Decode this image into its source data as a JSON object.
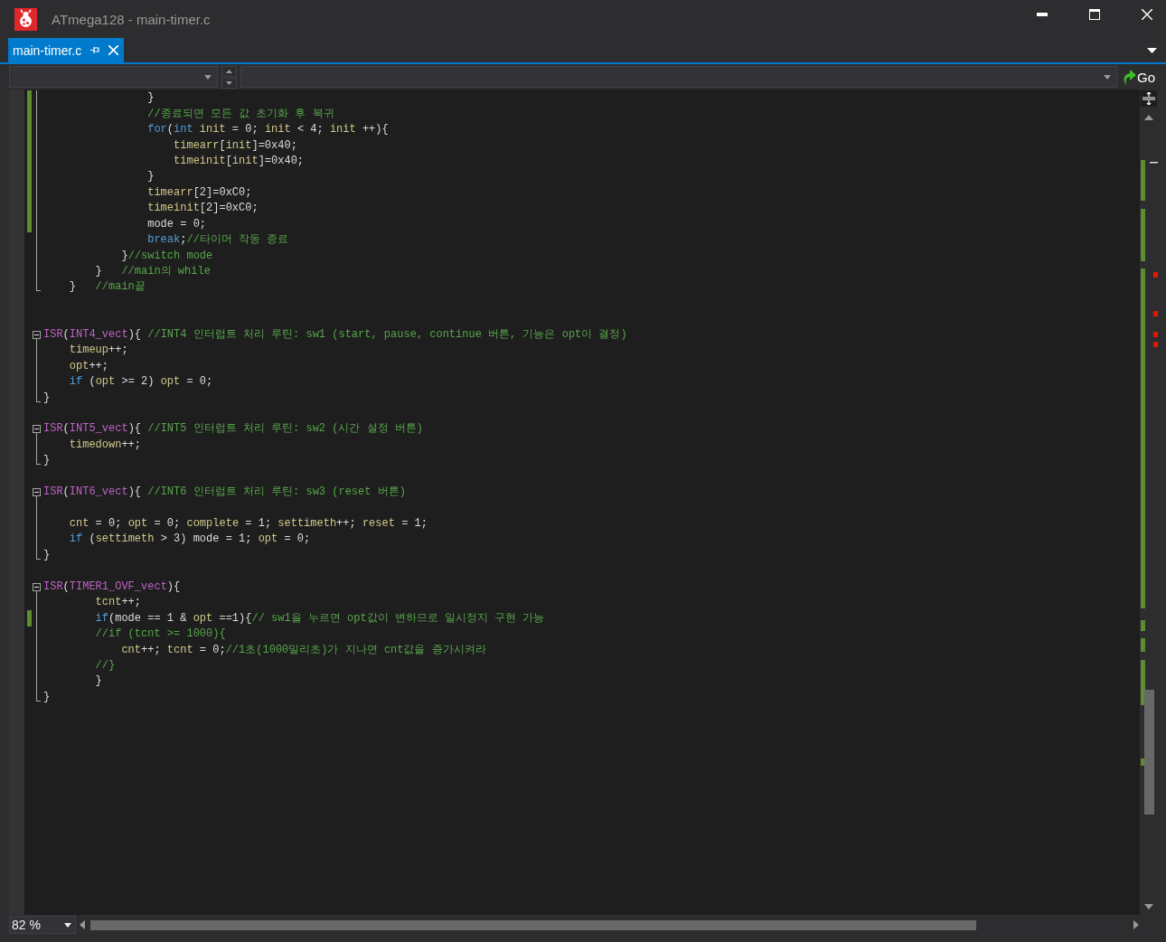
{
  "window": {
    "title": "ATmega128 - main-timer.c"
  },
  "tabs": [
    {
      "label": "main-timer.c",
      "selected": true
    }
  ],
  "navigation": {
    "go_label": "Go"
  },
  "editor": {
    "lines": [
      {
        "changed": true,
        "kind": "fold-body",
        "tokens": [
          {
            "kind": "plain",
            "text": "                }"
          }
        ]
      },
      {
        "changed": true,
        "kind": "fold-body",
        "tokens": [
          {
            "kind": "comment",
            "text": "                //종료되면 모든 값 초기화 후 복귀"
          }
        ]
      },
      {
        "changed": true,
        "kind": "fold-body",
        "tokens": [
          {
            "kind": "keyword",
            "text": "                for"
          },
          {
            "kind": "plain",
            "text": "("
          },
          {
            "kind": "keyword",
            "text": "int "
          },
          {
            "kind": "variable",
            "text": "init"
          },
          {
            "kind": "plain",
            "text": " = 0; "
          },
          {
            "kind": "variable",
            "text": "init"
          },
          {
            "kind": "plain",
            "text": " < 4; "
          },
          {
            "kind": "variable",
            "text": "init"
          },
          {
            "kind": "plain",
            "text": " ++){"
          }
        ]
      },
      {
        "changed": true,
        "kind": "fold-body",
        "tokens": [
          {
            "kind": "variable",
            "text": "                    timearr"
          },
          {
            "kind": "plain",
            "text": "["
          },
          {
            "kind": "variable",
            "text": "init"
          },
          {
            "kind": "plain",
            "text": "]=0x40;"
          }
        ]
      },
      {
        "changed": true,
        "kind": "fold-body",
        "tokens": [
          {
            "kind": "variable",
            "text": "                    timeinit"
          },
          {
            "kind": "plain",
            "text": "["
          },
          {
            "kind": "variable",
            "text": "init"
          },
          {
            "kind": "plain",
            "text": "]=0x40;"
          }
        ]
      },
      {
        "changed": true,
        "kind": "fold-body",
        "tokens": [
          {
            "kind": "plain",
            "text": "                }"
          }
        ]
      },
      {
        "changed": true,
        "kind": "fold-body",
        "tokens": [
          {
            "kind": "variable",
            "text": "                timearr"
          },
          {
            "kind": "plain",
            "text": "[2]=0xC0;"
          }
        ]
      },
      {
        "changed": true,
        "kind": "fold-body",
        "tokens": [
          {
            "kind": "variable",
            "text": "                timeinit"
          },
          {
            "kind": "plain",
            "text": "[2]=0xC0;"
          }
        ]
      },
      {
        "changed": true,
        "kind": "fold-body",
        "tokens": [
          {
            "kind": "plain",
            "text": "                mode = 0;"
          }
        ]
      },
      {
        "changed": false,
        "kind": "fold-body",
        "tokens": [
          {
            "kind": "keyword",
            "text": "                break"
          },
          {
            "kind": "plain",
            "text": ";"
          },
          {
            "kind": "comment",
            "text": "//타이머 작동 종료"
          }
        ]
      },
      {
        "changed": false,
        "kind": "fold-body",
        "tokens": [
          {
            "kind": "plain",
            "text": "            }"
          },
          {
            "kind": "comment",
            "text": "//switch mode"
          }
        ]
      },
      {
        "changed": false,
        "kind": "fold-body",
        "tokens": [
          {
            "kind": "plain",
            "text": "        }   "
          },
          {
            "kind": "comment",
            "text": "//main의 while"
          }
        ]
      },
      {
        "changed": false,
        "kind": "fold-end",
        "tokens": [
          {
            "kind": "plain",
            "text": "    }   "
          },
          {
            "kind": "comment",
            "text": "//main끝"
          }
        ]
      },
      {
        "changed": false,
        "kind": "blank"
      },
      {
        "changed": false,
        "kind": "blank"
      },
      {
        "changed": false,
        "kind": "fold-start",
        "tokens": [
          {
            "kind": "macro",
            "text": "ISR"
          },
          {
            "kind": "plain",
            "text": "("
          },
          {
            "kind": "macro",
            "text": "INT4_vect"
          },
          {
            "kind": "plain",
            "text": "){ "
          },
          {
            "kind": "comment",
            "text": "//INT4 인터럽트 처리 루틴: sw1 (start, pause, continue 버튼, 기능은 opt이 결정)"
          }
        ]
      },
      {
        "changed": false,
        "kind": "fold-body",
        "tokens": [
          {
            "kind": "variable",
            "text": "    timeup"
          },
          {
            "kind": "plain",
            "text": "++;"
          }
        ]
      },
      {
        "changed": false,
        "kind": "fold-body",
        "tokens": [
          {
            "kind": "variable",
            "text": "    opt"
          },
          {
            "kind": "plain",
            "text": "++;"
          }
        ]
      },
      {
        "changed": false,
        "kind": "fold-body",
        "tokens": [
          {
            "kind": "keyword",
            "text": "    if"
          },
          {
            "kind": "plain",
            "text": " ("
          },
          {
            "kind": "variable",
            "text": "opt"
          },
          {
            "kind": "plain",
            "text": " >= 2) "
          },
          {
            "kind": "variable",
            "text": "opt"
          },
          {
            "kind": "plain",
            "text": " = 0;"
          }
        ]
      },
      {
        "changed": false,
        "kind": "fold-end",
        "tokens": [
          {
            "kind": "plain",
            "text": "}"
          }
        ]
      },
      {
        "changed": false,
        "kind": "blank"
      },
      {
        "changed": false,
        "kind": "fold-start",
        "tokens": [
          {
            "kind": "macro",
            "text": "ISR"
          },
          {
            "kind": "plain",
            "text": "("
          },
          {
            "kind": "macro",
            "text": "INT5_vect"
          },
          {
            "kind": "plain",
            "text": "){ "
          },
          {
            "kind": "comment",
            "text": "//INT5 인터럽트 처리 루틴: sw2 (시간 설정 버튼)"
          }
        ]
      },
      {
        "changed": false,
        "kind": "fold-body",
        "tokens": [
          {
            "kind": "variable",
            "text": "    timedown"
          },
          {
            "kind": "plain",
            "text": "++;"
          }
        ]
      },
      {
        "changed": false,
        "kind": "fold-end",
        "tokens": [
          {
            "kind": "plain",
            "text": "}"
          }
        ]
      },
      {
        "changed": false,
        "kind": "blank"
      },
      {
        "changed": false,
        "kind": "fold-start",
        "tokens": [
          {
            "kind": "macro",
            "text": "ISR"
          },
          {
            "kind": "plain",
            "text": "("
          },
          {
            "kind": "macro",
            "text": "INT6_vect"
          },
          {
            "kind": "plain",
            "text": "){ "
          },
          {
            "kind": "comment",
            "text": "//INT6 인터럽트 처리 루틴: sw3 (reset 버튼)"
          }
        ]
      },
      {
        "changed": false,
        "kind": "fold-body"
      },
      {
        "changed": false,
        "kind": "fold-body",
        "tokens": [
          {
            "kind": "variable",
            "text": "    cnt"
          },
          {
            "kind": "plain",
            "text": " = 0; "
          },
          {
            "kind": "variable",
            "text": "opt"
          },
          {
            "kind": "plain",
            "text": " = 0; "
          },
          {
            "kind": "variable",
            "text": "complete"
          },
          {
            "kind": "plain",
            "text": " = 1; "
          },
          {
            "kind": "variable",
            "text": "settimeth"
          },
          {
            "kind": "plain",
            "text": "++; "
          },
          {
            "kind": "variable",
            "text": "reset"
          },
          {
            "kind": "plain",
            "text": " = 1;"
          }
        ]
      },
      {
        "changed": false,
        "kind": "fold-body",
        "tokens": [
          {
            "kind": "keyword",
            "text": "    if"
          },
          {
            "kind": "plain",
            "text": " ("
          },
          {
            "kind": "variable",
            "text": "settimeth"
          },
          {
            "kind": "plain",
            "text": " > 3) mode = 1; "
          },
          {
            "kind": "variable",
            "text": "opt"
          },
          {
            "kind": "plain",
            "text": " = 0;"
          }
        ]
      },
      {
        "changed": false,
        "kind": "fold-end",
        "tokens": [
          {
            "kind": "plain",
            "text": "}"
          }
        ]
      },
      {
        "changed": false,
        "kind": "blank"
      },
      {
        "changed": false,
        "kind": "fold-start",
        "tokens": [
          {
            "kind": "macro",
            "text": "ISR"
          },
          {
            "kind": "plain",
            "text": "("
          },
          {
            "kind": "macro",
            "text": "TIMER1_OVF_vect"
          },
          {
            "kind": "plain",
            "text": "){"
          }
        ]
      },
      {
        "changed": false,
        "kind": "fold-body",
        "tokens": [
          {
            "kind": "variable",
            "text": "        tcnt"
          },
          {
            "kind": "plain",
            "text": "++;"
          }
        ]
      },
      {
        "changed": true,
        "kind": "fold-body",
        "tokens": [
          {
            "kind": "keyword",
            "text": "        if"
          },
          {
            "kind": "plain",
            "text": "(mode == 1 & "
          },
          {
            "kind": "variable",
            "text": "opt"
          },
          {
            "kind": "plain",
            "text": " ==1){"
          },
          {
            "kind": "comment",
            "text": "// sw1을 누르면 opt값이 변하므로 일시정지 구현 가능"
          }
        ]
      },
      {
        "changed": false,
        "kind": "fold-body",
        "tokens": [
          {
            "kind": "comment",
            "text": "        //if (tcnt >= 1000){"
          }
        ]
      },
      {
        "changed": false,
        "kind": "fold-body",
        "tokens": [
          {
            "kind": "variable",
            "text": "            cnt"
          },
          {
            "kind": "plain",
            "text": "++; "
          },
          {
            "kind": "variable",
            "text": "tcnt"
          },
          {
            "kind": "plain",
            "text": " = 0;"
          },
          {
            "kind": "comment",
            "text": "//1초(1000밀리초)가 지나면 cnt값을 증가시켜라"
          }
        ]
      },
      {
        "changed": false,
        "kind": "fold-body",
        "tokens": [
          {
            "kind": "comment",
            "text": "        //}"
          }
        ]
      },
      {
        "changed": false,
        "kind": "fold-body",
        "tokens": [
          {
            "kind": "plain",
            "text": "        }"
          }
        ]
      },
      {
        "changed": false,
        "kind": "fold-end",
        "tokens": [
          {
            "kind": "plain",
            "text": "}"
          }
        ]
      }
    ]
  },
  "zoom": "82 %"
}
